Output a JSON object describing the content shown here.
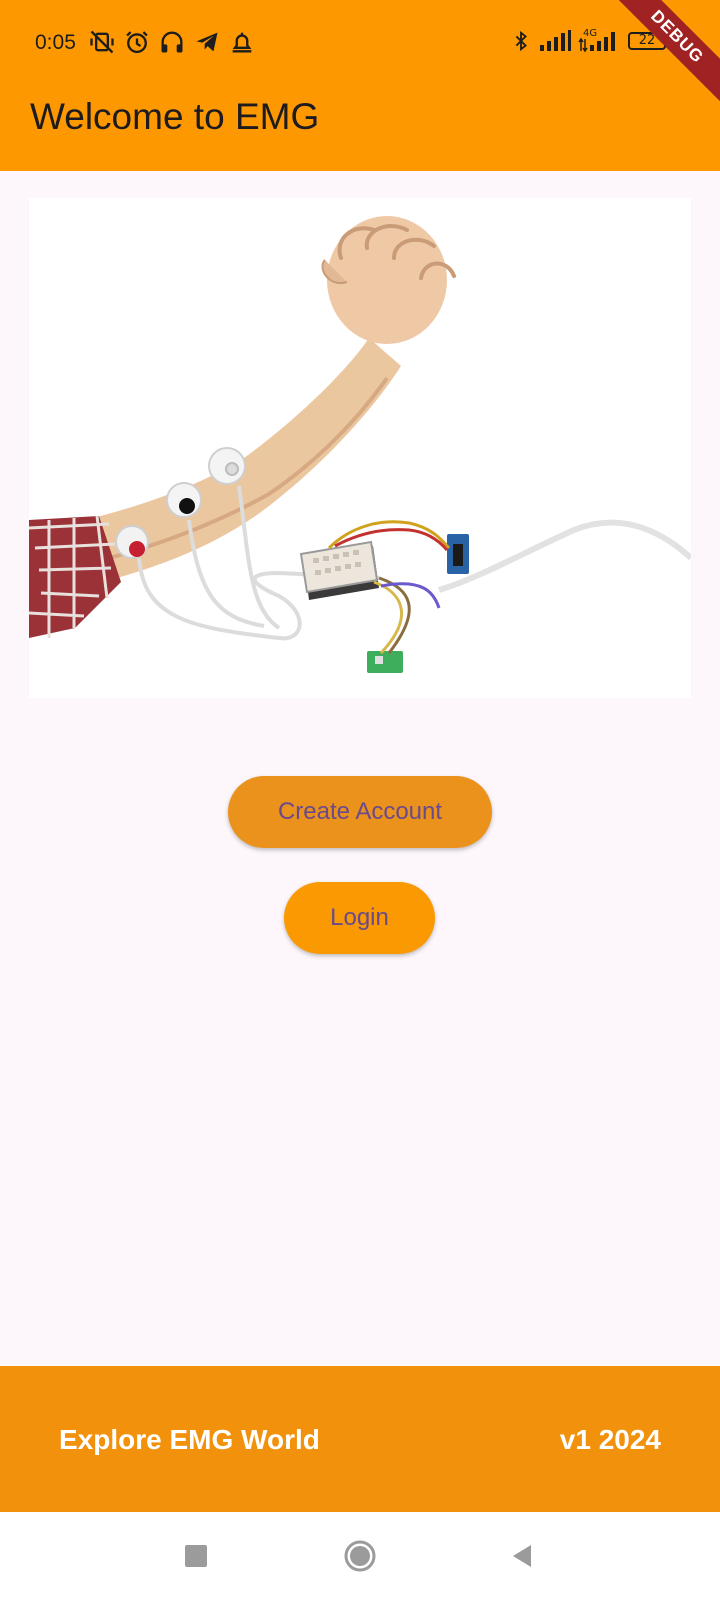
{
  "status_bar": {
    "time": "0:05",
    "network_label": "4G",
    "battery_level": "22",
    "left_icons": [
      "vibrate-off-icon",
      "alarm-icon",
      "headphones-icon",
      "telegram-icon",
      "alarm-bell-icon"
    ],
    "right_icons": [
      "bluetooth-icon",
      "signal-icon",
      "signal-4g-icon",
      "battery-icon"
    ]
  },
  "debug_banner": {
    "label": "DEBUG"
  },
  "app_bar": {
    "title": "Welcome to EMG",
    "background_color": "#fe9800"
  },
  "hero_image": {
    "alt": "Arm with EMG electrodes connected to a sensor board"
  },
  "actions": {
    "create_account_label": "Create Account",
    "login_label": "Login",
    "button_color": "#f09114",
    "button_text_color": "#6a4a8a"
  },
  "footer": {
    "left_text": "Explore EMG World",
    "right_text": "v1 2024",
    "background_color": "#f2910b"
  },
  "nav_bar": {
    "buttons": [
      "recents-icon",
      "home-icon",
      "back-icon"
    ]
  }
}
